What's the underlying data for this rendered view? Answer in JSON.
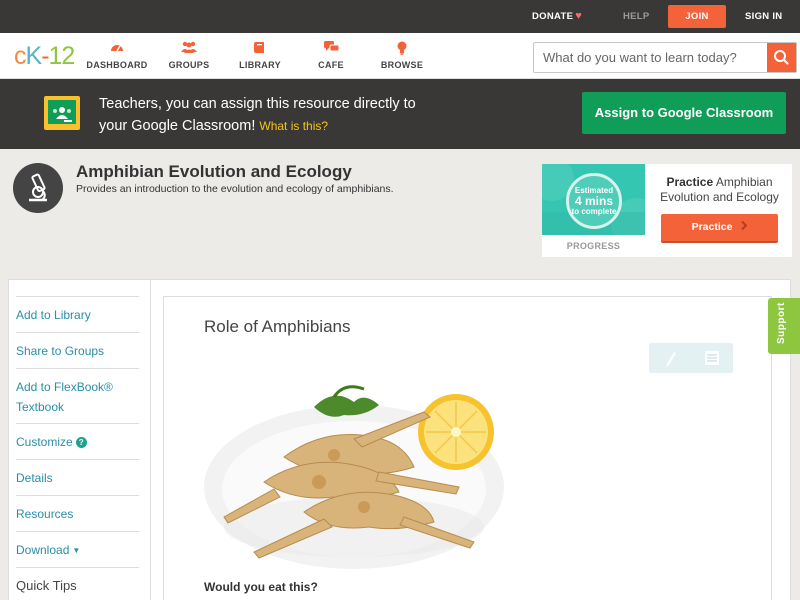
{
  "topbar": {
    "donate": "DONATE",
    "help": "HELP",
    "join": "JOIN",
    "signin": "SIGN IN"
  },
  "navbar": {
    "logo": {
      "c": "c",
      "k": "K",
      "dash": "-",
      "num": "12"
    },
    "items": [
      {
        "label": "DASHBOARD",
        "icon": "dashboard-gauge-icon"
      },
      {
        "label": "GROUPS",
        "icon": "groups-people-icon"
      },
      {
        "label": "LIBRARY",
        "icon": "library-book-icon"
      },
      {
        "label": "CAFE",
        "icon": "cafe-chat-icon"
      },
      {
        "label": "BROWSE",
        "icon": "browse-bulb-icon"
      }
    ],
    "search": {
      "placeholder": "What do you want to learn today?"
    }
  },
  "classroom_bar": {
    "text_line1": "Teachers, you can assign this resource directly to",
    "text_line2": "your Google Classroom!",
    "what_link": "What is this?",
    "assign_button": "Assign to Google Classroom"
  },
  "header": {
    "title": "Amphibian Evolution and Ecology",
    "description": "Provides an introduction to the evolution and ecology of amphibians.",
    "progress": {
      "line1": "Estimated",
      "minutes": "4 mins",
      "line3": "to complete",
      "label": "PROGRESS"
    },
    "practice": {
      "bold": "Practice",
      "rest": "Amphibian Evolution and Ecology",
      "button": "Practice"
    }
  },
  "sidebar": {
    "items": [
      {
        "label": "Add to Library"
      },
      {
        "label": "Share to Groups"
      },
      {
        "label": "Add to FlexBook® Textbook"
      },
      {
        "label": "Customize"
      },
      {
        "label": "Details"
      },
      {
        "label": "Resources"
      },
      {
        "label": "Download"
      },
      {
        "label": "Quick Tips"
      }
    ]
  },
  "content": {
    "title": "Role of Amphibians",
    "question": "Would you eat this?"
  },
  "support": "Support",
  "colors": {
    "accent_orange": "#f4623a",
    "google_green": "#0f9d58",
    "link_teal": "#2a8ea8",
    "support_green": "#8dc63f"
  }
}
